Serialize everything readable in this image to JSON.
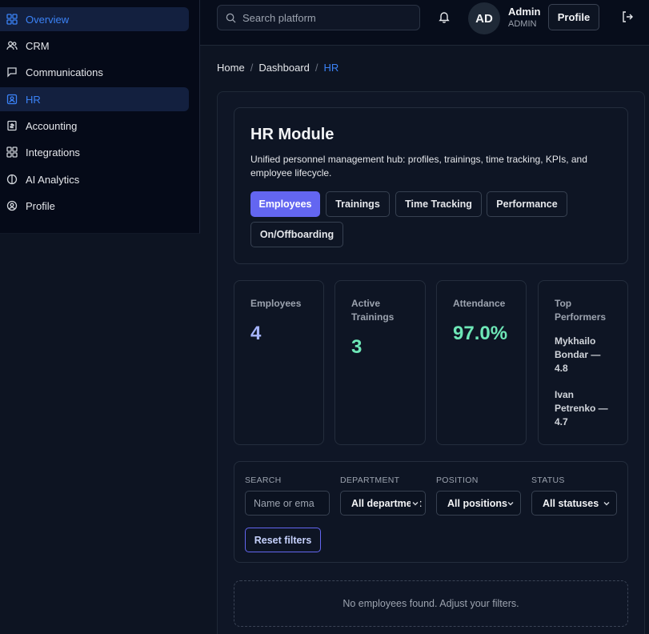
{
  "sidebar": {
    "items": [
      {
        "label": "Overview",
        "icon": "grid-icon",
        "active": true
      },
      {
        "label": "CRM",
        "icon": "users-icon",
        "active": false
      },
      {
        "label": "Communications",
        "icon": "chat-icon",
        "active": false
      },
      {
        "label": "HR",
        "icon": "id-badge-icon",
        "active": true
      },
      {
        "label": "Accounting",
        "icon": "receipt-icon",
        "active": false
      },
      {
        "label": "Integrations",
        "icon": "grid-icon",
        "active": false
      },
      {
        "label": "AI Analytics",
        "icon": "ai-icon",
        "active": false
      },
      {
        "label": "Profile",
        "icon": "user-circle-icon",
        "active": false
      }
    ]
  },
  "topbar": {
    "search_placeholder": "Search platform",
    "avatar_initials": "AD",
    "user_name": "Admin",
    "user_role": "ADMIN",
    "profile_label": "Profile"
  },
  "breadcrumb": {
    "home": "Home",
    "dashboard": "Dashboard",
    "current": "HR",
    "separator": "/"
  },
  "hr": {
    "title": "HR Module",
    "description": "Unified personnel management hub: profiles, trainings, time tracking, KPIs, and employee lifecycle.",
    "tabs": [
      "Employees",
      "Trainings",
      "Time Tracking",
      "Performance",
      "On/Offboarding"
    ],
    "active_tab": "Employees"
  },
  "stats": {
    "employees": {
      "label": "Employees",
      "value": "4"
    },
    "trainings": {
      "label": "Active Trainings",
      "value": "3"
    },
    "attendance": {
      "label": "Attendance",
      "value": "97.0%"
    },
    "top": {
      "label": "Top Performers",
      "performers": [
        "Mykhailo Bondar — 4.8",
        "Ivan Petrenko — 4.7"
      ]
    }
  },
  "filters": {
    "search_label": "SEARCH",
    "search_placeholder": "Name or ema",
    "department_label": "DEPARTMENT",
    "department_value": "All department",
    "position_label": "POSITION",
    "position_value": "All positions",
    "status_label": "STATUS",
    "status_value": "All statuses",
    "reset_label": "Reset filters"
  },
  "empty_message": "No employees found. Adjust your filters.",
  "colors": {
    "accent": "#6366f1",
    "link": "#3b82f6",
    "employees_value": "#a5b4fc",
    "positive_value": "#6ee7b7"
  }
}
